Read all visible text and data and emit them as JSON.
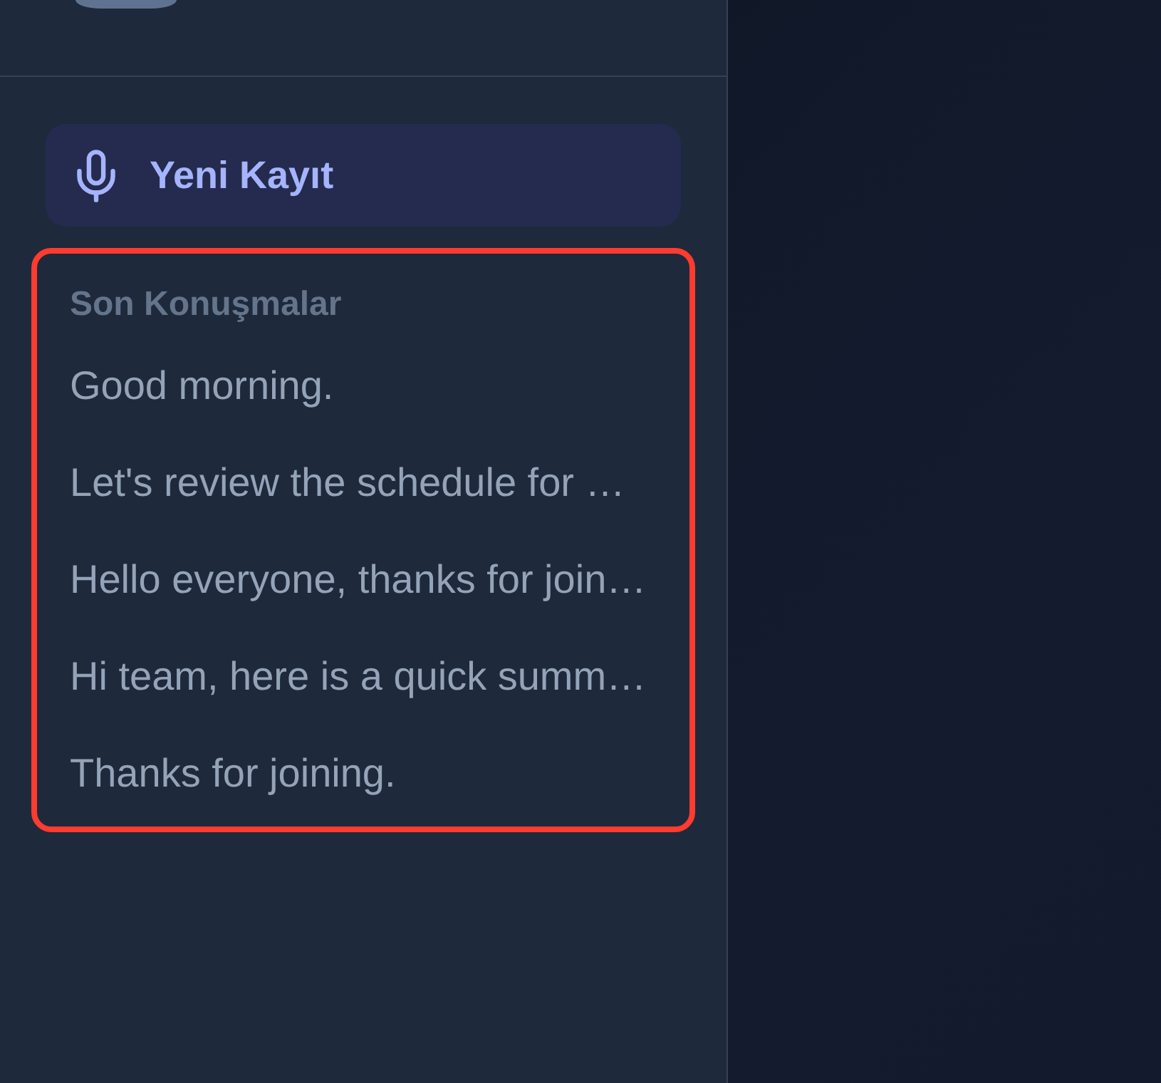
{
  "sidebar": {
    "new_recording_button": {
      "label": "Yeni Kayıt"
    },
    "recent_conversations": {
      "title": "Son Konuşmalar",
      "highlighted": true,
      "items": [
        {
          "label": "Good morning."
        },
        {
          "label": "Let's review the schedule for …"
        },
        {
          "label": "Hello everyone, thanks for join…"
        },
        {
          "label": "Hi team, here is a quick summ…"
        },
        {
          "label": "Thanks for joining."
        }
      ]
    }
  }
}
